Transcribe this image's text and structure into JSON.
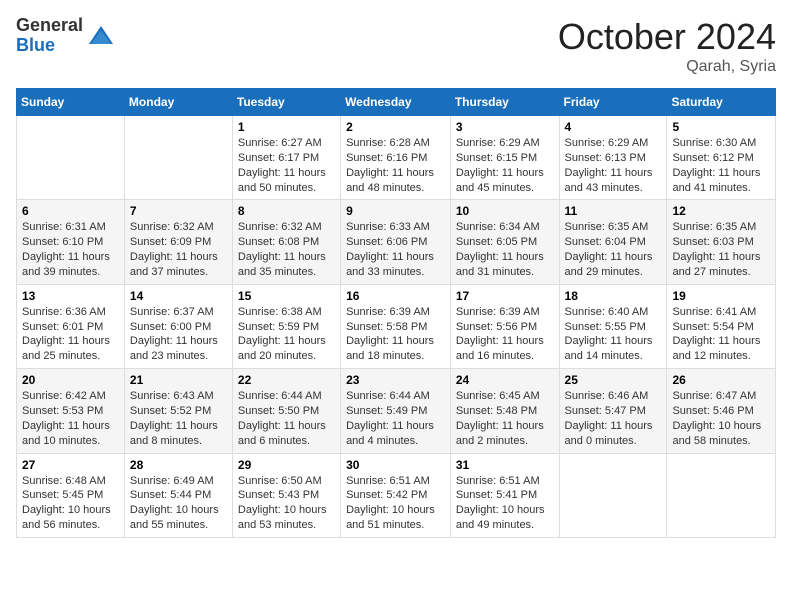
{
  "logo": {
    "general": "General",
    "blue": "Blue"
  },
  "header": {
    "month": "October 2024",
    "location": "Qarah, Syria"
  },
  "days_of_week": [
    "Sunday",
    "Monday",
    "Tuesday",
    "Wednesday",
    "Thursday",
    "Friday",
    "Saturday"
  ],
  "weeks": [
    [
      {
        "day": "",
        "sunrise": "",
        "sunset": "",
        "daylight": ""
      },
      {
        "day": "",
        "sunrise": "",
        "sunset": "",
        "daylight": ""
      },
      {
        "day": "1",
        "sunrise": "Sunrise: 6:27 AM",
        "sunset": "Sunset: 6:17 PM",
        "daylight": "Daylight: 11 hours and 50 minutes."
      },
      {
        "day": "2",
        "sunrise": "Sunrise: 6:28 AM",
        "sunset": "Sunset: 6:16 PM",
        "daylight": "Daylight: 11 hours and 48 minutes."
      },
      {
        "day": "3",
        "sunrise": "Sunrise: 6:29 AM",
        "sunset": "Sunset: 6:15 PM",
        "daylight": "Daylight: 11 hours and 45 minutes."
      },
      {
        "day": "4",
        "sunrise": "Sunrise: 6:29 AM",
        "sunset": "Sunset: 6:13 PM",
        "daylight": "Daylight: 11 hours and 43 minutes."
      },
      {
        "day": "5",
        "sunrise": "Sunrise: 6:30 AM",
        "sunset": "Sunset: 6:12 PM",
        "daylight": "Daylight: 11 hours and 41 minutes."
      }
    ],
    [
      {
        "day": "6",
        "sunrise": "Sunrise: 6:31 AM",
        "sunset": "Sunset: 6:10 PM",
        "daylight": "Daylight: 11 hours and 39 minutes."
      },
      {
        "day": "7",
        "sunrise": "Sunrise: 6:32 AM",
        "sunset": "Sunset: 6:09 PM",
        "daylight": "Daylight: 11 hours and 37 minutes."
      },
      {
        "day": "8",
        "sunrise": "Sunrise: 6:32 AM",
        "sunset": "Sunset: 6:08 PM",
        "daylight": "Daylight: 11 hours and 35 minutes."
      },
      {
        "day": "9",
        "sunrise": "Sunrise: 6:33 AM",
        "sunset": "Sunset: 6:06 PM",
        "daylight": "Daylight: 11 hours and 33 minutes."
      },
      {
        "day": "10",
        "sunrise": "Sunrise: 6:34 AM",
        "sunset": "Sunset: 6:05 PM",
        "daylight": "Daylight: 11 hours and 31 minutes."
      },
      {
        "day": "11",
        "sunrise": "Sunrise: 6:35 AM",
        "sunset": "Sunset: 6:04 PM",
        "daylight": "Daylight: 11 hours and 29 minutes."
      },
      {
        "day": "12",
        "sunrise": "Sunrise: 6:35 AM",
        "sunset": "Sunset: 6:03 PM",
        "daylight": "Daylight: 11 hours and 27 minutes."
      }
    ],
    [
      {
        "day": "13",
        "sunrise": "Sunrise: 6:36 AM",
        "sunset": "Sunset: 6:01 PM",
        "daylight": "Daylight: 11 hours and 25 minutes."
      },
      {
        "day": "14",
        "sunrise": "Sunrise: 6:37 AM",
        "sunset": "Sunset: 6:00 PM",
        "daylight": "Daylight: 11 hours and 23 minutes."
      },
      {
        "day": "15",
        "sunrise": "Sunrise: 6:38 AM",
        "sunset": "Sunset: 5:59 PM",
        "daylight": "Daylight: 11 hours and 20 minutes."
      },
      {
        "day": "16",
        "sunrise": "Sunrise: 6:39 AM",
        "sunset": "Sunset: 5:58 PM",
        "daylight": "Daylight: 11 hours and 18 minutes."
      },
      {
        "day": "17",
        "sunrise": "Sunrise: 6:39 AM",
        "sunset": "Sunset: 5:56 PM",
        "daylight": "Daylight: 11 hours and 16 minutes."
      },
      {
        "day": "18",
        "sunrise": "Sunrise: 6:40 AM",
        "sunset": "Sunset: 5:55 PM",
        "daylight": "Daylight: 11 hours and 14 minutes."
      },
      {
        "day": "19",
        "sunrise": "Sunrise: 6:41 AM",
        "sunset": "Sunset: 5:54 PM",
        "daylight": "Daylight: 11 hours and 12 minutes."
      }
    ],
    [
      {
        "day": "20",
        "sunrise": "Sunrise: 6:42 AM",
        "sunset": "Sunset: 5:53 PM",
        "daylight": "Daylight: 11 hours and 10 minutes."
      },
      {
        "day": "21",
        "sunrise": "Sunrise: 6:43 AM",
        "sunset": "Sunset: 5:52 PM",
        "daylight": "Daylight: 11 hours and 8 minutes."
      },
      {
        "day": "22",
        "sunrise": "Sunrise: 6:44 AM",
        "sunset": "Sunset: 5:50 PM",
        "daylight": "Daylight: 11 hours and 6 minutes."
      },
      {
        "day": "23",
        "sunrise": "Sunrise: 6:44 AM",
        "sunset": "Sunset: 5:49 PM",
        "daylight": "Daylight: 11 hours and 4 minutes."
      },
      {
        "day": "24",
        "sunrise": "Sunrise: 6:45 AM",
        "sunset": "Sunset: 5:48 PM",
        "daylight": "Daylight: 11 hours and 2 minutes."
      },
      {
        "day": "25",
        "sunrise": "Sunrise: 6:46 AM",
        "sunset": "Sunset: 5:47 PM",
        "daylight": "Daylight: 11 hours and 0 minutes."
      },
      {
        "day": "26",
        "sunrise": "Sunrise: 6:47 AM",
        "sunset": "Sunset: 5:46 PM",
        "daylight": "Daylight: 10 hours and 58 minutes."
      }
    ],
    [
      {
        "day": "27",
        "sunrise": "Sunrise: 6:48 AM",
        "sunset": "Sunset: 5:45 PM",
        "daylight": "Daylight: 10 hours and 56 minutes."
      },
      {
        "day": "28",
        "sunrise": "Sunrise: 6:49 AM",
        "sunset": "Sunset: 5:44 PM",
        "daylight": "Daylight: 10 hours and 55 minutes."
      },
      {
        "day": "29",
        "sunrise": "Sunrise: 6:50 AM",
        "sunset": "Sunset: 5:43 PM",
        "daylight": "Daylight: 10 hours and 53 minutes."
      },
      {
        "day": "30",
        "sunrise": "Sunrise: 6:51 AM",
        "sunset": "Sunset: 5:42 PM",
        "daylight": "Daylight: 10 hours and 51 minutes."
      },
      {
        "day": "31",
        "sunrise": "Sunrise: 6:51 AM",
        "sunset": "Sunset: 5:41 PM",
        "daylight": "Daylight: 10 hours and 49 minutes."
      },
      {
        "day": "",
        "sunrise": "",
        "sunset": "",
        "daylight": ""
      },
      {
        "day": "",
        "sunrise": "",
        "sunset": "",
        "daylight": ""
      }
    ]
  ]
}
